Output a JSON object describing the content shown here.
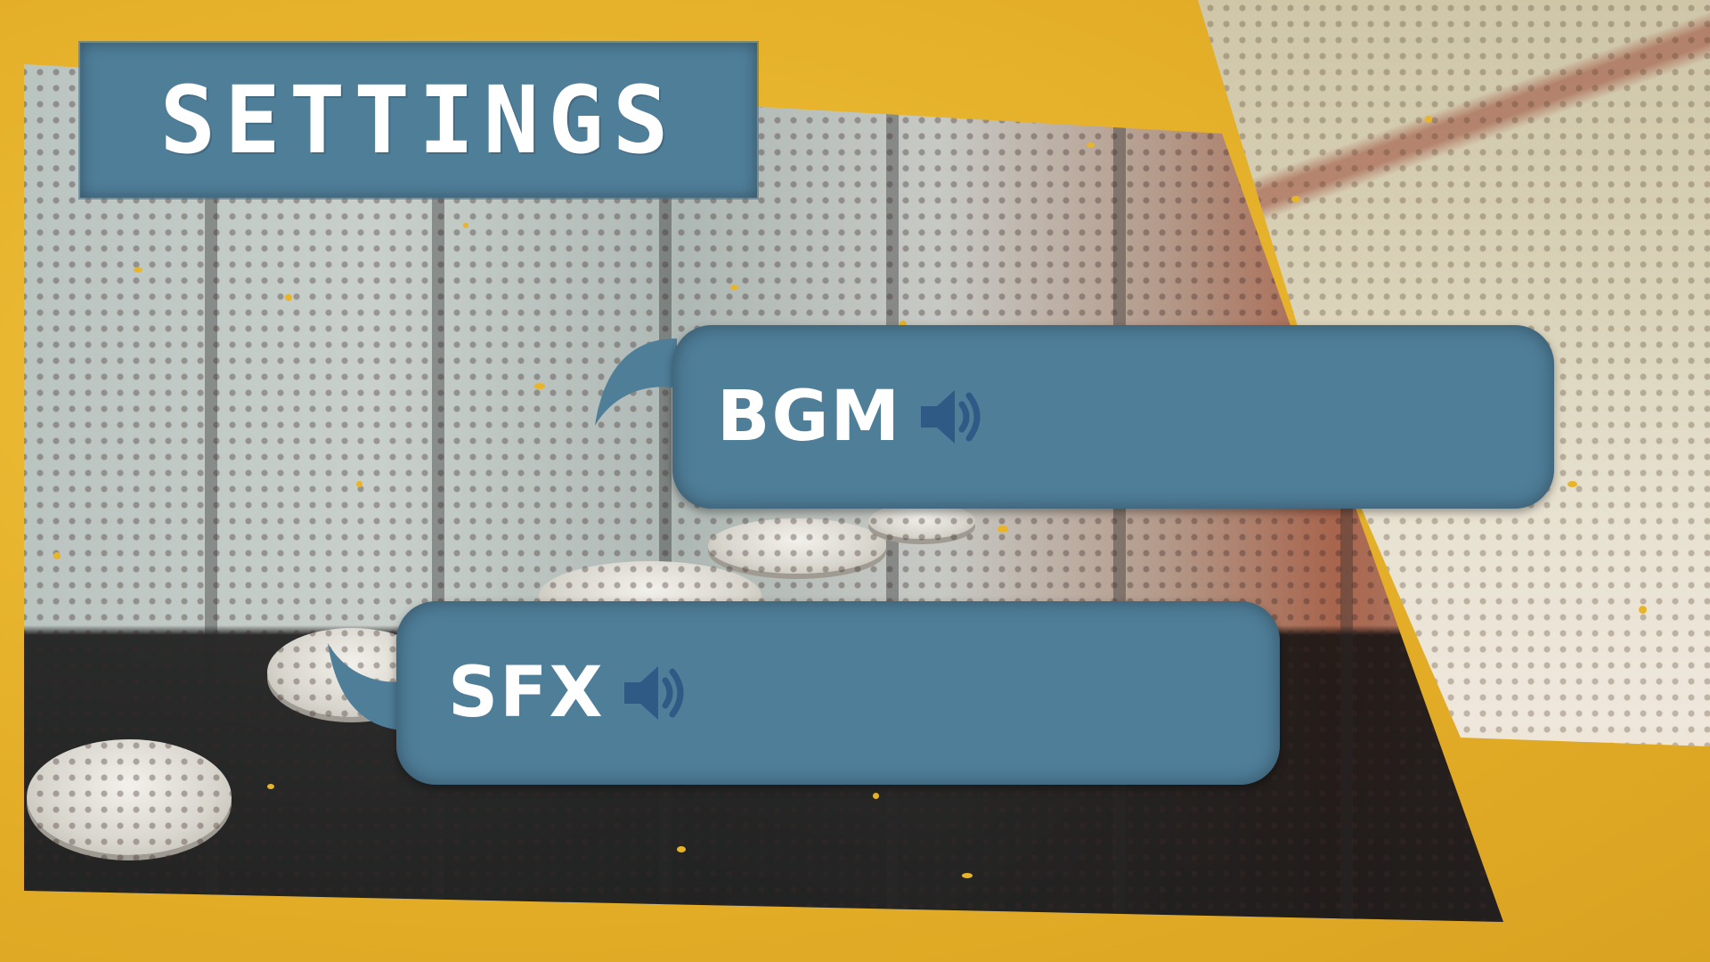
{
  "screen": {
    "title": "SETTINGS"
  },
  "options": [
    {
      "label": "BGM",
      "icon": "speaker-volume-icon"
    },
    {
      "label": "SFX",
      "icon": "speaker-volume-icon"
    }
  ],
  "colors": {
    "background_yellow": "#e6b52b",
    "panel_blue": "#4f7e99",
    "icon_blue": "#2f5a86",
    "text_white": "#ffffff"
  }
}
